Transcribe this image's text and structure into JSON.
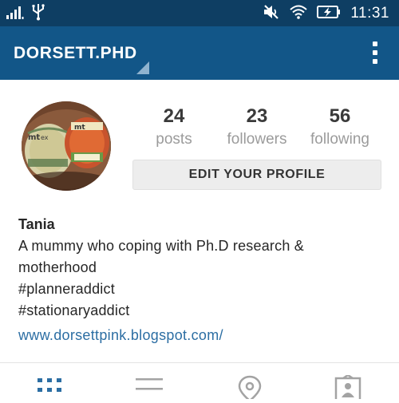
{
  "status_bar": {
    "time": "11:31"
  },
  "app_bar": {
    "username": "DORSETT.PHD"
  },
  "profile": {
    "stats": [
      {
        "value": "24",
        "label": "posts"
      },
      {
        "value": "23",
        "label": "followers"
      },
      {
        "value": "56",
        "label": "following"
      }
    ],
    "edit_button_label": "EDIT YOUR PROFILE",
    "name": "Tania",
    "bio_lines": [
      "A mummy who coping with Ph.D research &",
      "motherhood",
      "#planneraddict",
      "#stationaryaddict"
    ],
    "website": "www.dorsettpink.blogspot.com/"
  },
  "colors": {
    "status_bar": "#0e3e63",
    "app_bar": "#125688",
    "link": "#2c6ea3",
    "active_tab": "#2c6ea3",
    "inactive_tab": "#a3a3a3"
  },
  "tabs": [
    {
      "icon": "grid-icon",
      "active": true
    },
    {
      "icon": "list-icon",
      "active": false
    },
    {
      "icon": "location-pin-icon",
      "active": false
    },
    {
      "icon": "tagged-person-icon",
      "active": false
    }
  ]
}
